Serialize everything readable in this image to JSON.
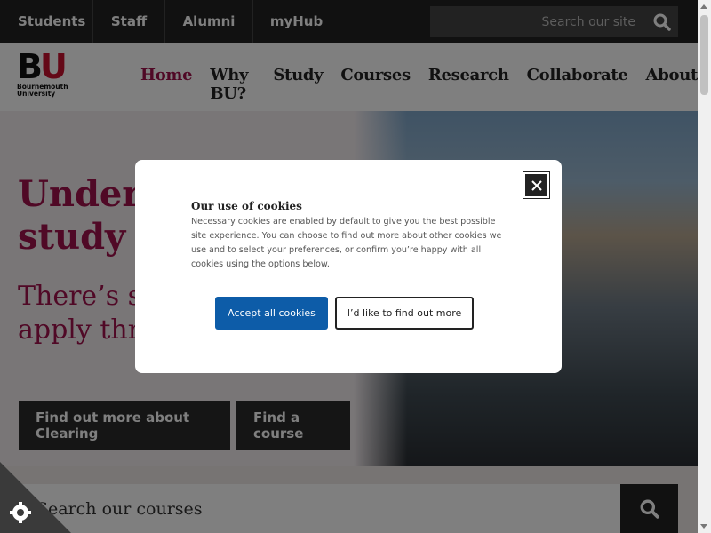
{
  "topbar": {
    "links": [
      "Students",
      "Staff",
      "Alumni",
      "myHub"
    ],
    "search_placeholder": "Search our site"
  },
  "header": {
    "logo_letters_b": "B",
    "logo_letters_u": "U",
    "logo_uni_line1": "Bournemouth",
    "logo_uni_line2": "University",
    "nav": [
      "Home",
      "Why BU?",
      "Study",
      "Courses",
      "Research",
      "Collaborate",
      "About"
    ],
    "active_nav": "Home"
  },
  "hero": {
    "title": "Undergraduate study",
    "subtitle": "There’s still time to apply through Clearing",
    "button1": "Find out more about Clearing",
    "button2": "Find a course"
  },
  "course_search": {
    "placeholder": "Search our courses"
  },
  "cookie_modal": {
    "title": "Our use of cookies",
    "body": "Necessary cookies are enabled by default to give you the best possible site experience. You can choose to find out more about other cookies we use and to select your preferences, or confirm you’re happy with all cookies using the options below.",
    "accept": "Accept all cookies",
    "more": "I’d like to find out more"
  },
  "colors": {
    "brand_magenta": "#a1124c",
    "accept_blue": "#0d5ca8",
    "dark": "#222222"
  },
  "icons": [
    "search-icon",
    "close-icon",
    "cookie-icon"
  ]
}
